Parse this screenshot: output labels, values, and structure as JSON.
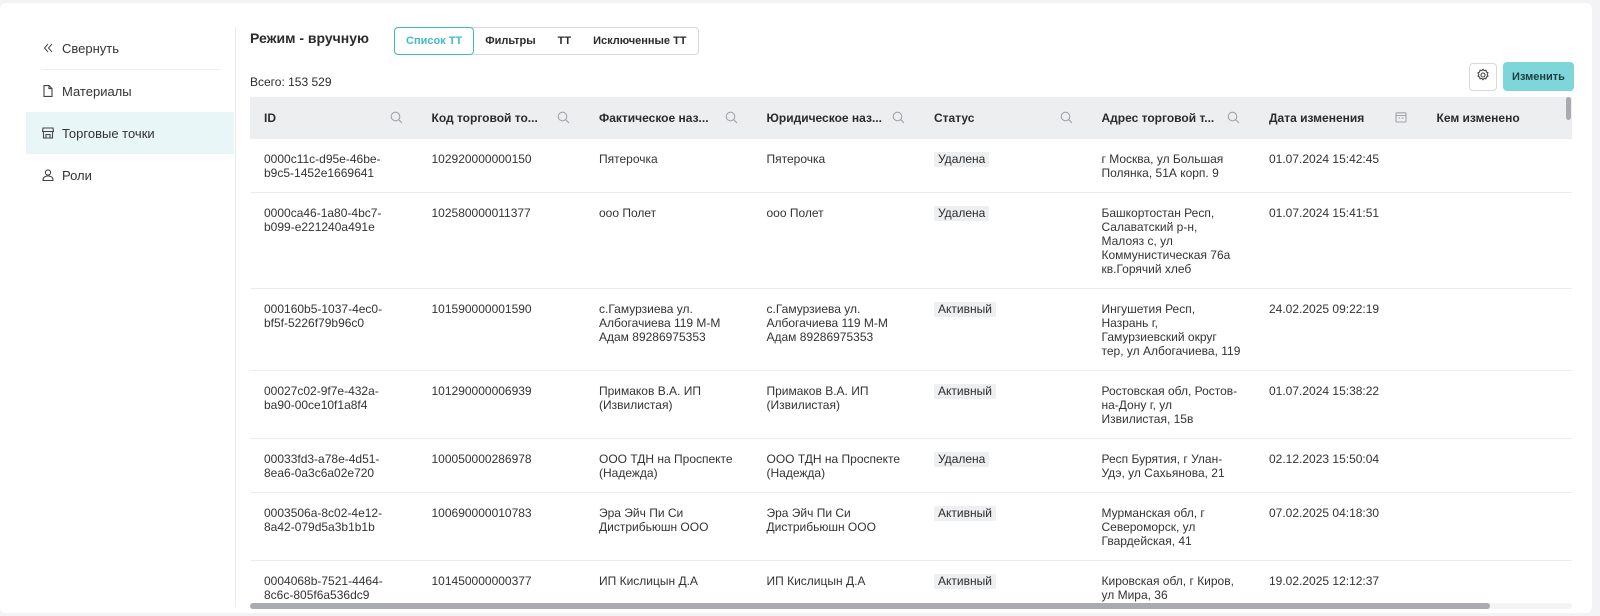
{
  "sidebar": {
    "items": [
      {
        "label": "Свернуть",
        "icon": "collapse-chevrons-icon"
      },
      {
        "label": "Материалы",
        "icon": "document-icon"
      },
      {
        "label": "Торговые точки",
        "icon": "store-icon",
        "active": true
      },
      {
        "label": "Роли",
        "icon": "user-icon"
      }
    ]
  },
  "header": {
    "title": "Режим - вручную",
    "tabs": [
      {
        "label": "Список ТТ",
        "active": true
      },
      {
        "label": "Фильтры"
      },
      {
        "label": "ТТ"
      },
      {
        "label": "Исключенные ТТ"
      }
    ],
    "total": "Всего: 153 529",
    "edit_button": "Изменить"
  },
  "colors": {
    "accent": "#3fbcc3",
    "button": "#7dd6da",
    "active_nav": "#e8f6f7",
    "table_header": "#edeef0"
  },
  "table": {
    "columns": [
      {
        "label": "ID",
        "icon": "search-icon"
      },
      {
        "label": "Код торговой то...",
        "icon": "search-icon"
      },
      {
        "label": "Фактическое наз...",
        "icon": "search-icon"
      },
      {
        "label": "Юридическое наз...",
        "icon": "search-icon"
      },
      {
        "label": "Статус",
        "icon": "search-icon"
      },
      {
        "label": "Адрес торговой т...",
        "icon": "search-icon"
      },
      {
        "label": "Дата изменения",
        "icon": "calendar-icon"
      },
      {
        "label": "Кем изменено"
      }
    ],
    "rows": [
      [
        "0000c11c-d95e-46be-b9c5-1452e1669641",
        "102920000000150",
        "Пятерочка",
        "Пятерочка",
        "Удалена",
        "г Москва, ул Большая Полянка, 51А корп. 9",
        "01.07.2024 15:42:45",
        ""
      ],
      [
        "0000ca46-1a80-4bc7-b099-e221240a491e",
        "102580000011377",
        "ооо Полет",
        "ооо Полет",
        "Удалена",
        "Башкортостан Респ, Салаватский р-н, Малояз с, ул Коммунистическая 76а кв.Горячий хлеб",
        "01.07.2024 15:41:51",
        ""
      ],
      [
        "000160b5-1037-4ec0-bf5f-5226f79b96c0",
        "101590000001590",
        "с.Гамурзиева ул. Албогачиева 119 М-М Адам 89286975353",
        "с.Гамурзиева ул. Албогачиева 119 М-М Адам 89286975353",
        "Активный",
        "Ингушетия Респ, Назрань г, Гамурзиевский округ тер, ул Албогачиева, 119",
        "24.02.2025 09:22:19",
        ""
      ],
      [
        "00027c02-9f7e-432a-ba90-00ce10f1a8f4",
        "101290000006939",
        "Примаков В.А. ИП (Извилистая)",
        "Примаков В.А. ИП (Извилистая)",
        "Активный",
        "Ростовская обл, Ростов-на-Дону г, ул Извилистая, 15в",
        "01.07.2024 15:38:22",
        ""
      ],
      [
        "00033fd3-a78e-4d51-8ea6-0a3c6a02e720",
        "100050000286978",
        "ООО ТДН на Проспекте (Надежда)",
        "ООО ТДН на Проспекте (Надежда)",
        "Удалена",
        "Респ Бурятия, г Улан-Удэ, ул Сахьянова, 21",
        "02.12.2023 15:50:04",
        ""
      ],
      [
        "0003506a-8c02-4e12-8a42-079d5a3b1b1b",
        "100690000010783",
        "Эра Эйч Пи Си Дистрибьюшн ООО",
        "Эра Эйч Пи Си Дистрибьюшн ООО",
        "Активный",
        "Мурманская обл, г Североморск, ул Гвардейская, 41",
        "07.02.2025 04:18:30",
        ""
      ],
      [
        "0004068b-7521-4464-8c6c-805f6a536dc9",
        "101450000000377",
        "ИП Кислицын Д.А",
        "ИП Кислицын Д.А",
        "Активный",
        "Кировская обл, г Киров, ул Мира, 36",
        "19.02.2025 12:12:37",
        ""
      ]
    ]
  }
}
